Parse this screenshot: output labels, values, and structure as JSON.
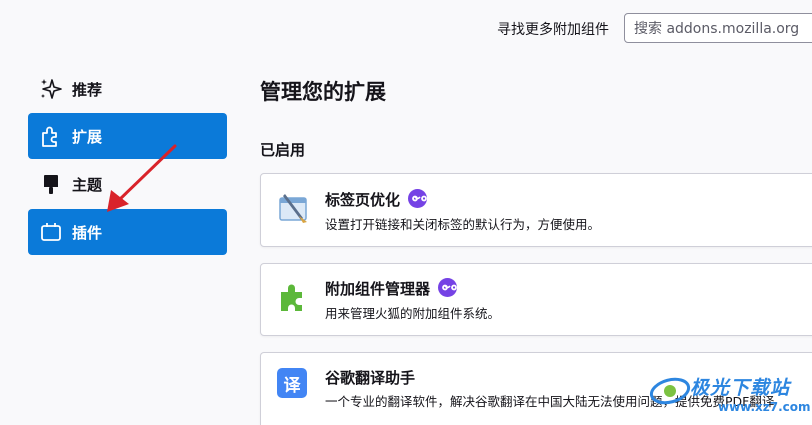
{
  "header": {
    "find_more_label": "寻找更多附加组件",
    "search_placeholder": "搜索 addons.mozilla.org"
  },
  "sidebar": {
    "items": [
      {
        "label": "推荐",
        "icon": "sparkle-icon",
        "active": false
      },
      {
        "label": "扩展",
        "icon": "puzzle-icon",
        "active": true
      },
      {
        "label": "主题",
        "icon": "paintbrush-icon",
        "active": false
      },
      {
        "label": "插件",
        "icon": "plugin-icon",
        "active": true
      }
    ]
  },
  "main": {
    "title": "管理您的扩展",
    "enabled_section": "已启用",
    "extensions": [
      {
        "name": "标签页优化",
        "description": "设置打开链接和关闭标签的默认行为，方便使用。",
        "icon": "tab-tweak-icon",
        "badge": "mozilla-badge-icon"
      },
      {
        "name": "附加组件管理器",
        "description": "用来管理火狐的附加组件系统。",
        "icon": "green-puzzle-icon",
        "badge": "mozilla-badge-icon"
      },
      {
        "name": "谷歌翻译助手",
        "description": "一个专业的翻译软件，解决谷歌翻译在中国大陆无法使用问题，提供免费PDF翻译",
        "icon_text": "译"
      }
    ]
  },
  "watermark": {
    "title": "极光下载站",
    "url": "www.xz7.com"
  },
  "colors": {
    "accent": "#0b7ad9",
    "badge": "#7542e5",
    "arrow": "#d9232a"
  }
}
